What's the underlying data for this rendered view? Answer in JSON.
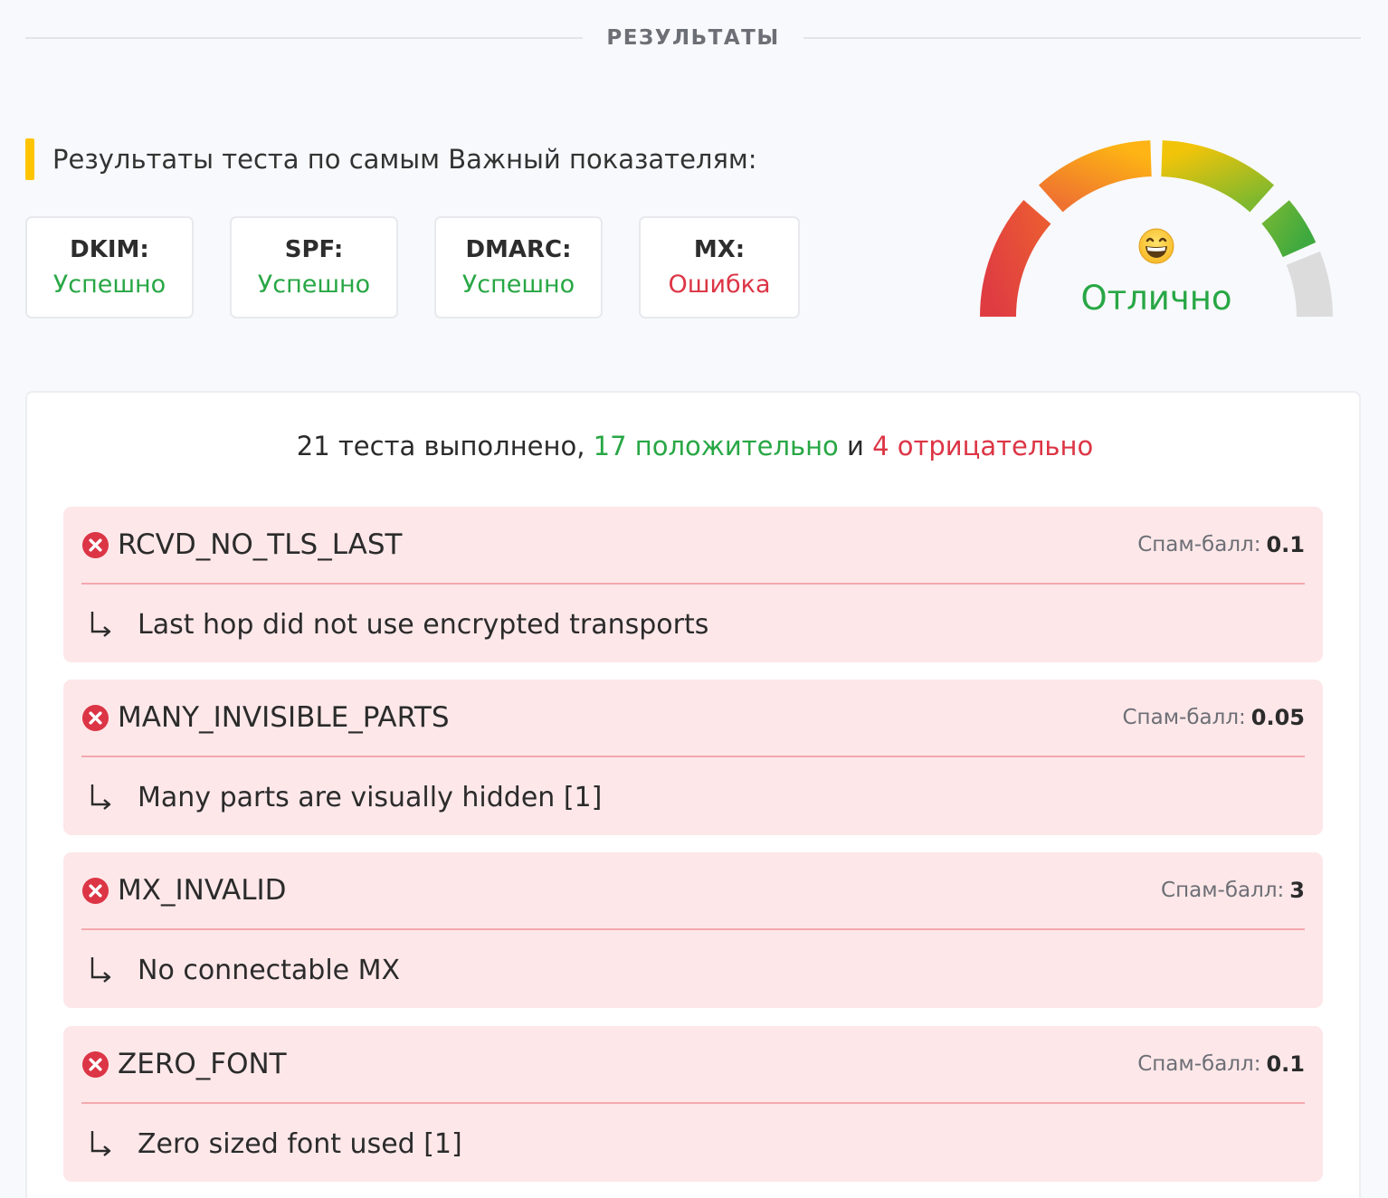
{
  "section": {
    "title": "РЕЗУЛЬТАТЫ"
  },
  "important": {
    "title": "Результаты теста по самым Важный показателям:",
    "indicators": [
      {
        "label": "DKIM:",
        "value": "Успешно",
        "status": "ok"
      },
      {
        "label": "SPF:",
        "value": "Успешно",
        "status": "ok"
      },
      {
        "label": "DMARC:",
        "value": "Успешно",
        "status": "ok"
      },
      {
        "label": "MX:",
        "value": "Ошибка",
        "status": "error"
      }
    ]
  },
  "gauge": {
    "rating": "Отлично",
    "emoji_icon": "grinning-face-icon",
    "level_segments_filled": 4,
    "segments_total": 5,
    "colors": {
      "red": "#e23d3d",
      "orange": "#f2862a",
      "yellow_green": "#c6c21e",
      "green": "#4bae3c",
      "empty": "#dcdcdc",
      "rating_text": "#28a745"
    }
  },
  "summary": {
    "total_text": "21 теста выполнено, ",
    "positive_text": "17 положительно",
    "and_text": " и ",
    "negative_text": "4 отрицательно"
  },
  "tests": [
    {
      "name": "RCVD_NO_TLS_LAST",
      "score_label": "Спам-балл:",
      "score": "0.1",
      "description": "Last hop did not use encrypted transports"
    },
    {
      "name": "MANY_INVISIBLE_PARTS",
      "score_label": "Спам-балл:",
      "score": "0.05",
      "description": "Many parts are visually hidden [1]"
    },
    {
      "name": "MX_INVALID",
      "score_label": "Спам-балл:",
      "score": "3",
      "description": "No connectable MX"
    },
    {
      "name": "ZERO_FONT",
      "score_label": "Спам-балл:",
      "score": "0.1",
      "description": "Zero sized font used [1]"
    }
  ],
  "colors": {
    "ok": "#28a745",
    "error": "#dc3545",
    "accent_bar": "#ffc400",
    "card_bg": "#fde7e9",
    "card_divider": "#f4a9ae"
  }
}
